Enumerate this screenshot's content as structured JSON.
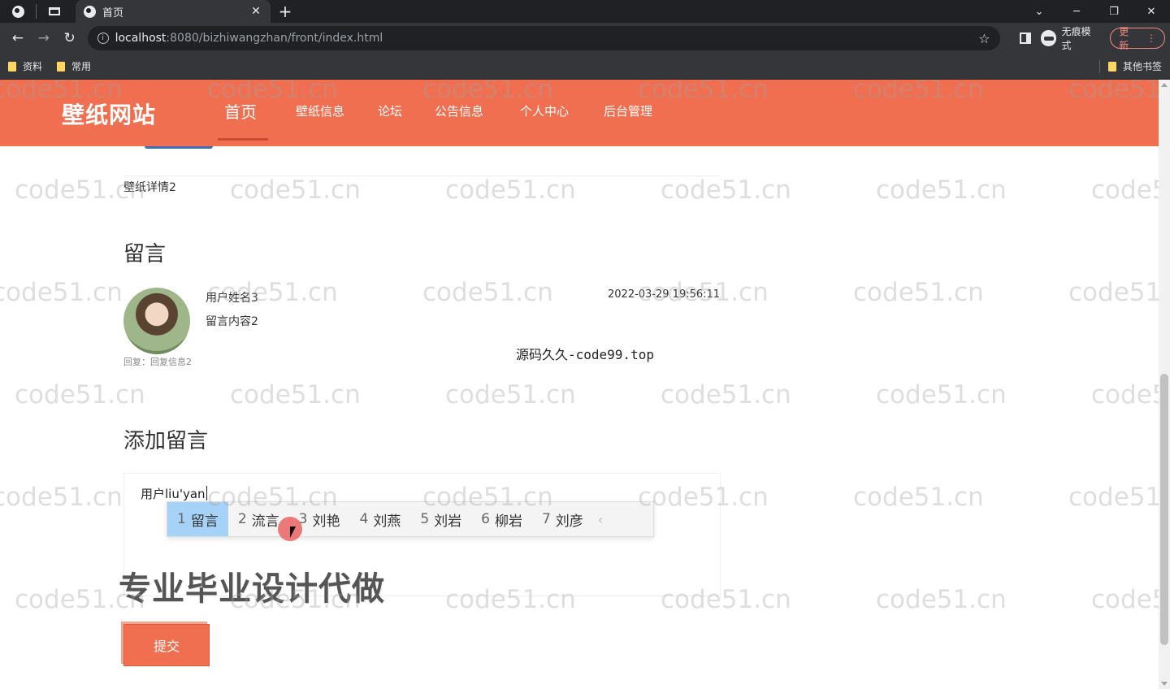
{
  "browser": {
    "tab_title": "首页",
    "url_host": "localhost",
    "url_path": ":8080/bizhiwangzhan/front/index.html",
    "incognito_label": "无痕模式",
    "update_label": "更新",
    "bookmarks": [
      "资料",
      "常用"
    ],
    "other_bookmarks": "其他书签"
  },
  "site": {
    "logo": "壁纸网站",
    "nav": [
      "首页",
      "壁纸信息",
      "论坛",
      "公告信息",
      "个人中心",
      "后台管理"
    ],
    "active_nav": "首页"
  },
  "detail": {
    "title": "壁纸详情2"
  },
  "messages": {
    "heading": "留言",
    "items": [
      {
        "user": "用户姓名3",
        "content": "留言内容2",
        "time": "2022-03-29 19:56:11",
        "reply": "回复：回复信息2"
      }
    ]
  },
  "overlay_text": "源码久久-code99.top",
  "add_message": {
    "heading": "添加留言",
    "input_value": "用户liu'yan",
    "submit_label": "提交"
  },
  "ime": {
    "candidates": [
      {
        "num": "1",
        "text": "留言"
      },
      {
        "num": "2",
        "text": "流言"
      },
      {
        "num": "3",
        "text": "刘艳"
      },
      {
        "num": "4",
        "text": "刘燕"
      },
      {
        "num": "5",
        "text": "刘岩"
      },
      {
        "num": "6",
        "text": "柳岩"
      },
      {
        "num": "7",
        "text": "刘彦"
      }
    ],
    "prev_arrow": "‹"
  },
  "promo_text": "专业毕业设计代做",
  "watermark": "code51.cn",
  "colors": {
    "nav_bg": "#ef6f50",
    "ime_selected": "#a7d2f7",
    "button_bg": "#ef6f50"
  }
}
